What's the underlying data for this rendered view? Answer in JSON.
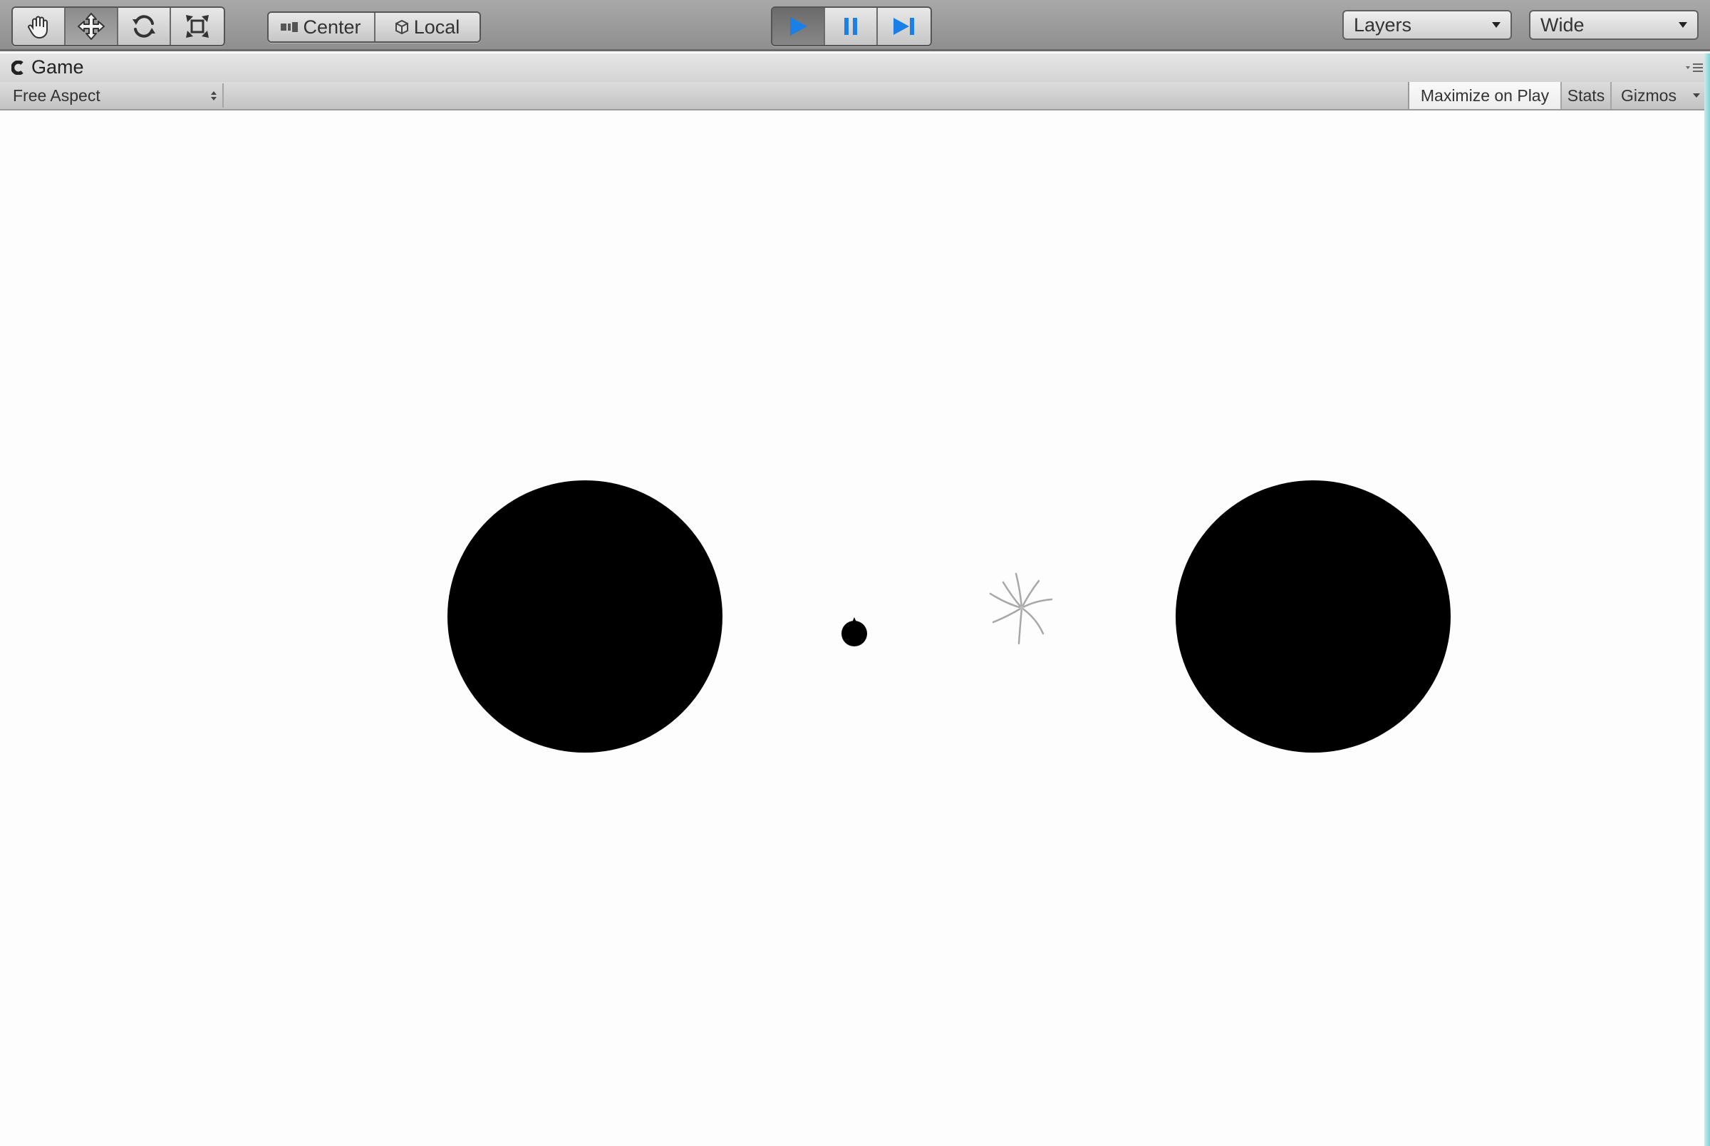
{
  "toolbar": {
    "tools": [
      {
        "name": "hand-tool",
        "icon": "hand-icon"
      },
      {
        "name": "move-tool",
        "icon": "move-arrows-icon",
        "active": true
      },
      {
        "name": "rotate-tool",
        "icon": "rotate-icon"
      },
      {
        "name": "scale-tool",
        "icon": "scale-icon"
      }
    ],
    "pivot_center_label": "Center",
    "pivot_local_label": "Local",
    "playback": {
      "play_icon": "play-icon",
      "pause_icon": "pause-icon",
      "step_icon": "step-icon",
      "playing": true
    },
    "layers_label": "Layers",
    "layout_label": "Wide"
  },
  "game_tab": {
    "title": "Game",
    "icon": "game-controller-icon",
    "aspect_label": "Free Aspect",
    "maximize_label": "Maximize on Play",
    "stats_label": "Stats",
    "gizmos_label": "Gizmos"
  },
  "scene": {
    "objects": [
      "left-planet",
      "small-ball",
      "sparkle-effect",
      "right-planet"
    ],
    "background_color": "#fdfdfd",
    "object_color": "#000000"
  },
  "colors": {
    "toolbar_bg": "#9a9a9a",
    "play_blue": "#1a7fe6",
    "accent_edge": "#79d6da"
  }
}
